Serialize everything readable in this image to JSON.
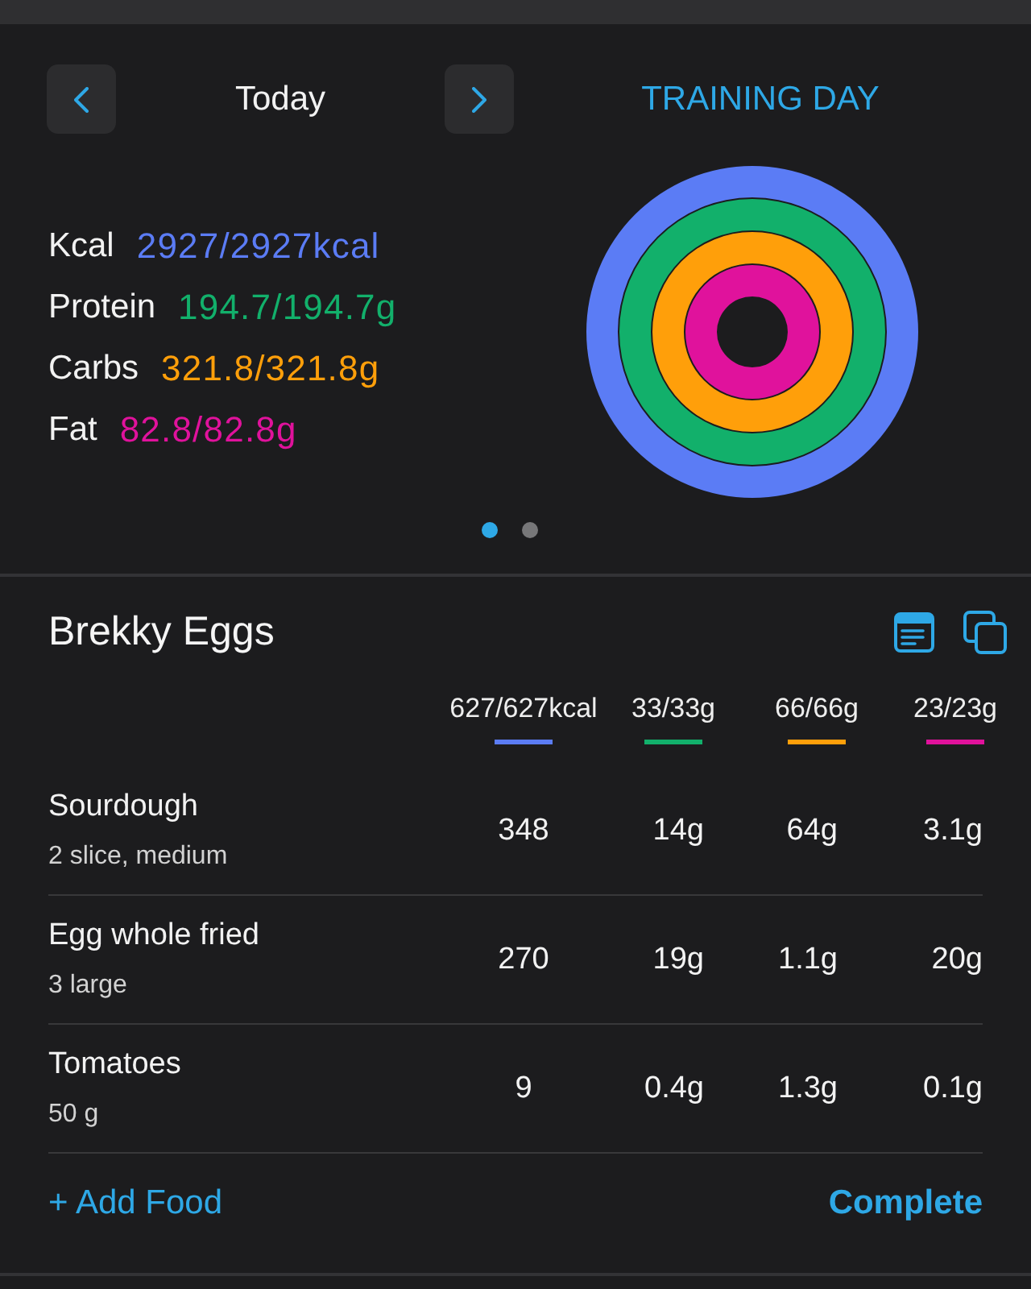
{
  "header": {
    "date_label": "Today",
    "day_type": "TRAINING DAY"
  },
  "macros": [
    {
      "label": "Kcal",
      "value": "2927/2927kcal",
      "color": "#5b7cf5"
    },
    {
      "label": "Protein",
      "value": "194.7/194.7g",
      "color": "#12b06b"
    },
    {
      "label": "Carbs",
      "value": "321.8/321.8g",
      "color": "#ff9f0a"
    },
    {
      "label": "Fat",
      "value": "82.8/82.8g",
      "color": "#e0129c"
    }
  ],
  "pager": [
    {
      "selected": true
    },
    {
      "selected": false
    }
  ],
  "meal": {
    "title": "Brekky Eggs",
    "columns": [
      {
        "total": "627/627kcal",
        "color": "#5b7cf5"
      },
      {
        "total": "33/33g",
        "color": "#12b06b"
      },
      {
        "total": "66/66g",
        "color": "#ff9f0a"
      },
      {
        "total": "23/23g",
        "color": "#e0129c"
      }
    ],
    "rows": [
      {
        "name": "Sourdough",
        "portion": "2 slice, medium",
        "values": [
          "348",
          "14g",
          "64g",
          "3.1g"
        ]
      },
      {
        "name": "Egg whole fried",
        "portion": "3 large",
        "values": [
          "270",
          "19g",
          "1.1g",
          "20g"
        ]
      },
      {
        "name": "Tomatoes",
        "portion": "50 g",
        "values": [
          "9",
          "0.4g",
          "1.3g",
          "0.1g"
        ]
      }
    ],
    "add_label": "+ Add Food",
    "complete_label": "Complete"
  }
}
